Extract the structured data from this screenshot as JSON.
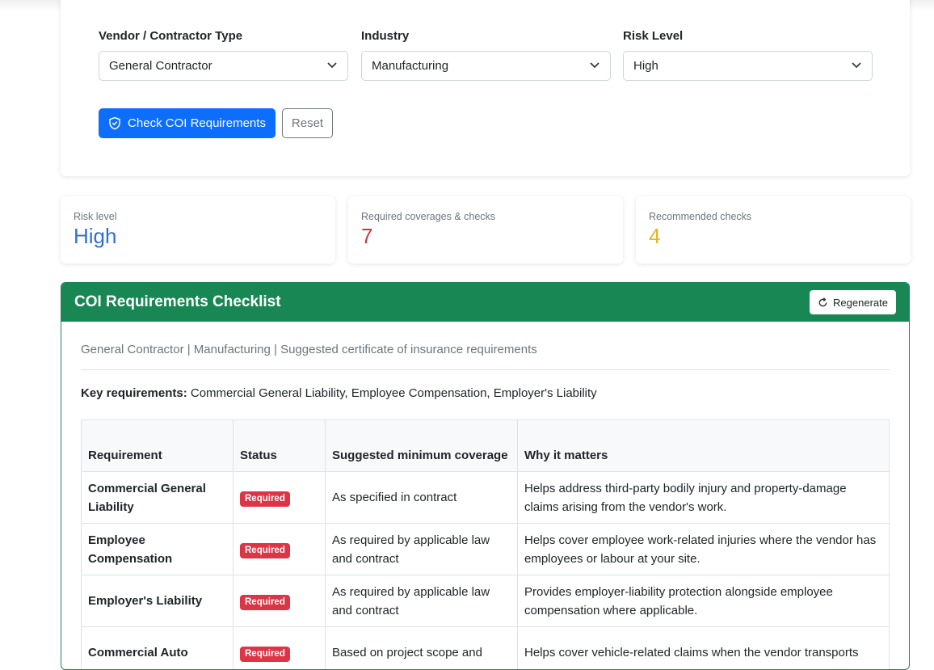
{
  "form": {
    "vendor_label": "Vendor / Contractor Type",
    "vendor_value": "General Contractor",
    "industry_label": "Industry",
    "industry_value": "Manufacturing",
    "risk_label": "Risk Level",
    "risk_value": "High",
    "check_button": "Check COI Requirements",
    "reset_button": "Reset"
  },
  "stats": [
    {
      "label": "Risk level",
      "value": "High",
      "color": "#2f6fd6"
    },
    {
      "label": "Required coverages & checks",
      "value": "7",
      "color": "#c9384a"
    },
    {
      "label": "Recommended checks",
      "value": "4",
      "color": "#e6b325"
    }
  ],
  "checklist": {
    "title": "COI Requirements Checklist",
    "regenerate_button": "Regenerate",
    "subtitle": "General Contractor | Manufacturing | Suggested certificate of insurance requirements",
    "key_label": "Key requirements:",
    "key_text": " Commercial General Liability, Employee Compensation, Employer's Liability",
    "columns": [
      "Requirement",
      "Status",
      "Suggested minimum coverage",
      "Why it matters"
    ],
    "rows": [
      {
        "requirement": "Commercial General Liability",
        "status": "Required",
        "coverage": "As specified in contract",
        "why": "Helps address third-party bodily injury and property-damage claims arising from the vendor's work."
      },
      {
        "requirement": "Employee Compensation",
        "status": "Required",
        "coverage": "As required by applicable law and contract",
        "why": "Helps cover employee work-related injuries where the vendor has employees or labour at your site."
      },
      {
        "requirement": "Employer's Liability",
        "status": "Required",
        "coverage": "As required by applicable law and contract",
        "why": "Provides employer-liability protection alongside employee compensation where applicable."
      },
      {
        "requirement": "Commercial Auto",
        "status": "Required",
        "coverage": "Based on project scope and",
        "why": "Helps cover vehicle-related claims when the vendor transports"
      }
    ]
  },
  "colors": {
    "primary": "#0d6efd",
    "success": "#198754",
    "danger": "#dc3545"
  }
}
